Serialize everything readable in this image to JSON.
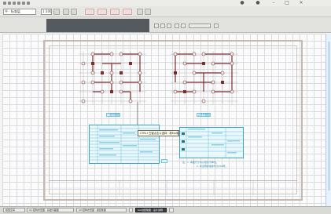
{
  "window": {
    "title_icons": [
      "save-icon",
      "open-icon",
      "undo-icon",
      "redo-icon",
      "print-icon",
      "cut-icon"
    ]
  },
  "toolbar": {
    "layer_field": "平 · 标准层",
    "scale_field": "1:100",
    "big_buttons": [
      {
        "icon": "draw-icon",
        "label": "绘制"
      },
      {
        "icon": "wall-icon",
        "label": "墙体"
      },
      {
        "icon": "door-icon",
        "label": "门窗"
      },
      {
        "icon": "flag-icon",
        "label": "标注"
      }
    ]
  },
  "drawing": {
    "plan_left_label": "一层平面图",
    "plan_right_label": "二层平面图",
    "tooltip": "CTRL+左键点击以选择 · 按Esc取消选择",
    "note_text": "注：1. 本图尺寸均以毫米为单位。",
    "note_text2": "2. 未注明的墙体均为240厚。"
  },
  "tabs": [
    {
      "label": "模型空间"
    },
    {
      "label": "A1-结构布置图 · 基础平面图"
    },
    {
      "label": "A2-结构布置图 · 梁配筋图"
    },
    {
      "label": "A3-结构布置图 · 板配筋"
    },
    {
      "label": "A4-柱配筋图 · 设计说明",
      "active": true
    }
  ],
  "colors": {
    "canvas": "#fbfbfb",
    "grid": "#d8dbe0",
    "cad_lines": "#7a2e2e",
    "table_blue": "#3aa3c6"
  }
}
